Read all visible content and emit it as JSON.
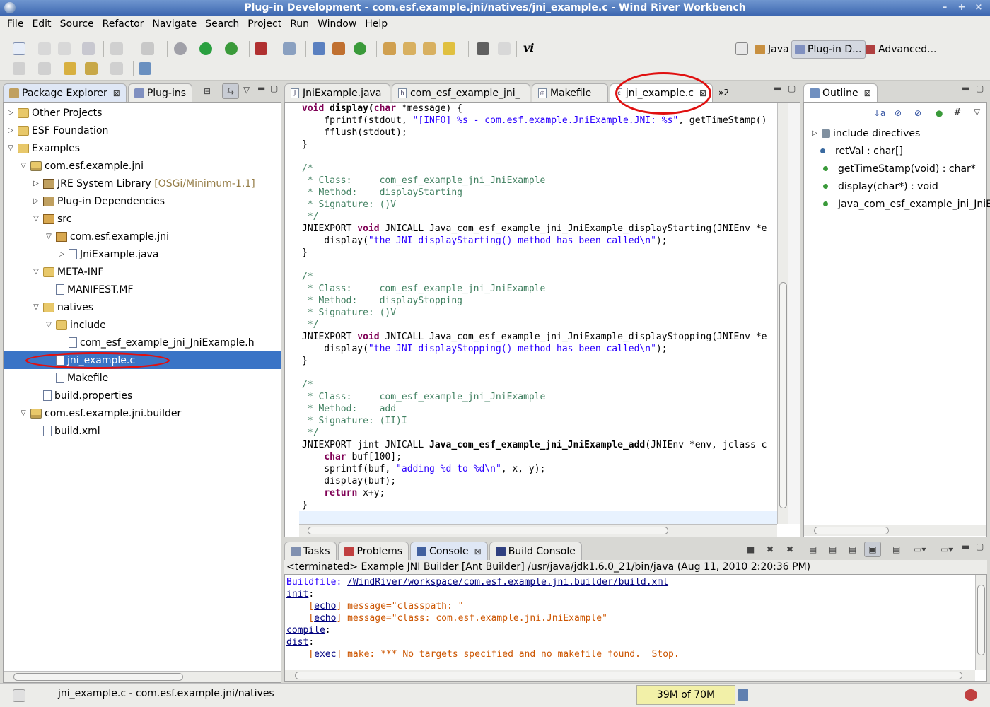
{
  "window": {
    "title": "Plug-in Development - com.esf.example.jni/natives/jni_example.c - Wind River Workbench",
    "min": "–",
    "max": "+",
    "close": "×"
  },
  "menu": [
    "File",
    "Edit",
    "Source",
    "Refactor",
    "Navigate",
    "Search",
    "Project",
    "Run",
    "Window",
    "Help"
  ],
  "perspectives": {
    "java": "Java",
    "plugin": "Plug-in D...",
    "advanced": "Advanced..."
  },
  "left_tabs": {
    "explorer": "Package Explorer",
    "plugins": "Plug-ins"
  },
  "tree": [
    {
      "label": "Other Projects",
      "arrow": "▷",
      "icon": "folder"
    },
    {
      "label": "ESF Foundation",
      "arrow": "▷",
      "icon": "folder"
    },
    {
      "label": "Examples",
      "arrow": "▽",
      "icon": "folder"
    },
    {
      "label": "com.esf.example.jni",
      "arrow": "▽",
      "icon": "proj"
    },
    {
      "label": "JRE System Library",
      "extra": "[OSGi/Minimum-1.1]",
      "arrow": "▷",
      "icon": "lib"
    },
    {
      "label": "Plug-in Dependencies",
      "arrow": "▷",
      "icon": "lib"
    },
    {
      "label": "src",
      "arrow": "▽",
      "icon": "pkg"
    },
    {
      "label": "com.esf.example.jni",
      "arrow": "▽",
      "icon": "pkg"
    },
    {
      "label": "JniExample.java",
      "arrow": "▷",
      "icon": "jfile"
    },
    {
      "label": "META-INF",
      "arrow": "▽",
      "icon": "folder"
    },
    {
      "label": "MANIFEST.MF",
      "arrow": "",
      "icon": "jfile"
    },
    {
      "label": "natives",
      "arrow": "▽",
      "icon": "folder"
    },
    {
      "label": "include",
      "arrow": "▽",
      "icon": "folder"
    },
    {
      "label": "com_esf_example_jni_JniExample.h",
      "arrow": "",
      "icon": "cfile"
    },
    {
      "label": "jni_example.c",
      "arrow": "",
      "icon": "cfile"
    },
    {
      "label": "Makefile",
      "arrow": "",
      "icon": "jfile"
    },
    {
      "label": "build.properties",
      "arrow": "",
      "icon": "jfile"
    },
    {
      "label": "com.esf.example.jni.builder",
      "arrow": "▽",
      "icon": "proj"
    },
    {
      "label": "build.xml",
      "arrow": "",
      "icon": "jfile"
    }
  ],
  "editor_tabs": {
    "t1": "JniExample.java",
    "t2": "com_esf_example_jni_",
    "t3": "Makefile",
    "t4": "jni_example.c",
    "more": "»2"
  },
  "code": {
    "l1a": "void",
    "l1b": " display(",
    "l1c": "char",
    "l1d": " *message) {",
    "l2a": "    fprintf(stdout, ",
    "l2b": "\"[INFO] %s - com.esf.example.JniExample.JNI: %s\"",
    "l2c": ", getTimeStamp()",
    "l3": "    fflush(stdout);",
    "l4": "}",
    "c1": "/*\n * Class:     com_esf_example_jni_JniExample\n * Method:    displayStarting\n * Signature: ()V\n */",
    "f1a": "JNIEXPORT ",
    "f1b": "void",
    "f1c": " JNICALL Java_com_esf_example_jni_JniExample_displayStarting(JNIEnv *e",
    "f1d": "    display(",
    "f1e": "\"the JNI displayStarting() method has been called\\n\"",
    "f1f": ");",
    "c2": "/*\n * Class:     com_esf_example_jni_JniExample\n * Method:    displayStopping\n * Signature: ()V\n */",
    "f2c": " JNICALL Java_com_esf_example_jni_JniExample_displayStopping(JNIEnv *e",
    "f2e": "\"the JNI displayStopping() method has been called\\n\"",
    "c3": "/*\n * Class:     com_esf_example_jni_JniExample\n * Method:    add\n * Signature: (II)I\n */",
    "f3a": "JNIEXPORT jint JNICALL ",
    "f3b": "Java_com_esf_example_jni_JniExample_add",
    "f3c": "(JNIEnv *env, jclass c",
    "f3d": "    ",
    "f3e": "char",
    "f3f": " buf[100];",
    "f3g": "    sprintf(buf, ",
    "f3h": "\"adding %d to %d\\n\"",
    "f3i": ", x, y);",
    "f3j": "    display(buf);",
    "f3k": "    ",
    "f3l": "return",
    "f3m": " x+y;"
  },
  "outline": {
    "tab": "Outline",
    "items": [
      "include directives",
      "retVal : char[]",
      "getTimeStamp(void) : char*",
      "display(char*) : void",
      "Java_com_esf_example_jni_JniE"
    ]
  },
  "bottom_tabs": {
    "tasks": "Tasks",
    "problems": "Problems",
    "console": "Console",
    "build": "Build Console"
  },
  "console": {
    "header": "<terminated> Example JNI Builder [Ant Builder] /usr/java/jdk1.6.0_21/bin/java (Aug 11, 2010 2:20:36 PM)",
    "buildfile_label": "Buildfile: ",
    "buildfile_path": "/WindRiver/workspace/com.esf.example.jni.builder/build.xml",
    "init": "init",
    "echo": "echo",
    "echo1": " message=\"classpath: \"",
    "echo2": " message=\"class: com.esf.example.jni.JniExample\"",
    "compile": "compile",
    "dist": "dist",
    "exec": "exec",
    "exec_msg": " make: *** No targets specified and no makefile found.  Stop."
  },
  "status": {
    "text": "jni_example.c - com.esf.example.jni/natives",
    "memory": "39M of 70M"
  },
  "colors": {
    "selection": "#3a74c6",
    "annotation": "#e01010",
    "title_bar": "#4a73b8"
  }
}
